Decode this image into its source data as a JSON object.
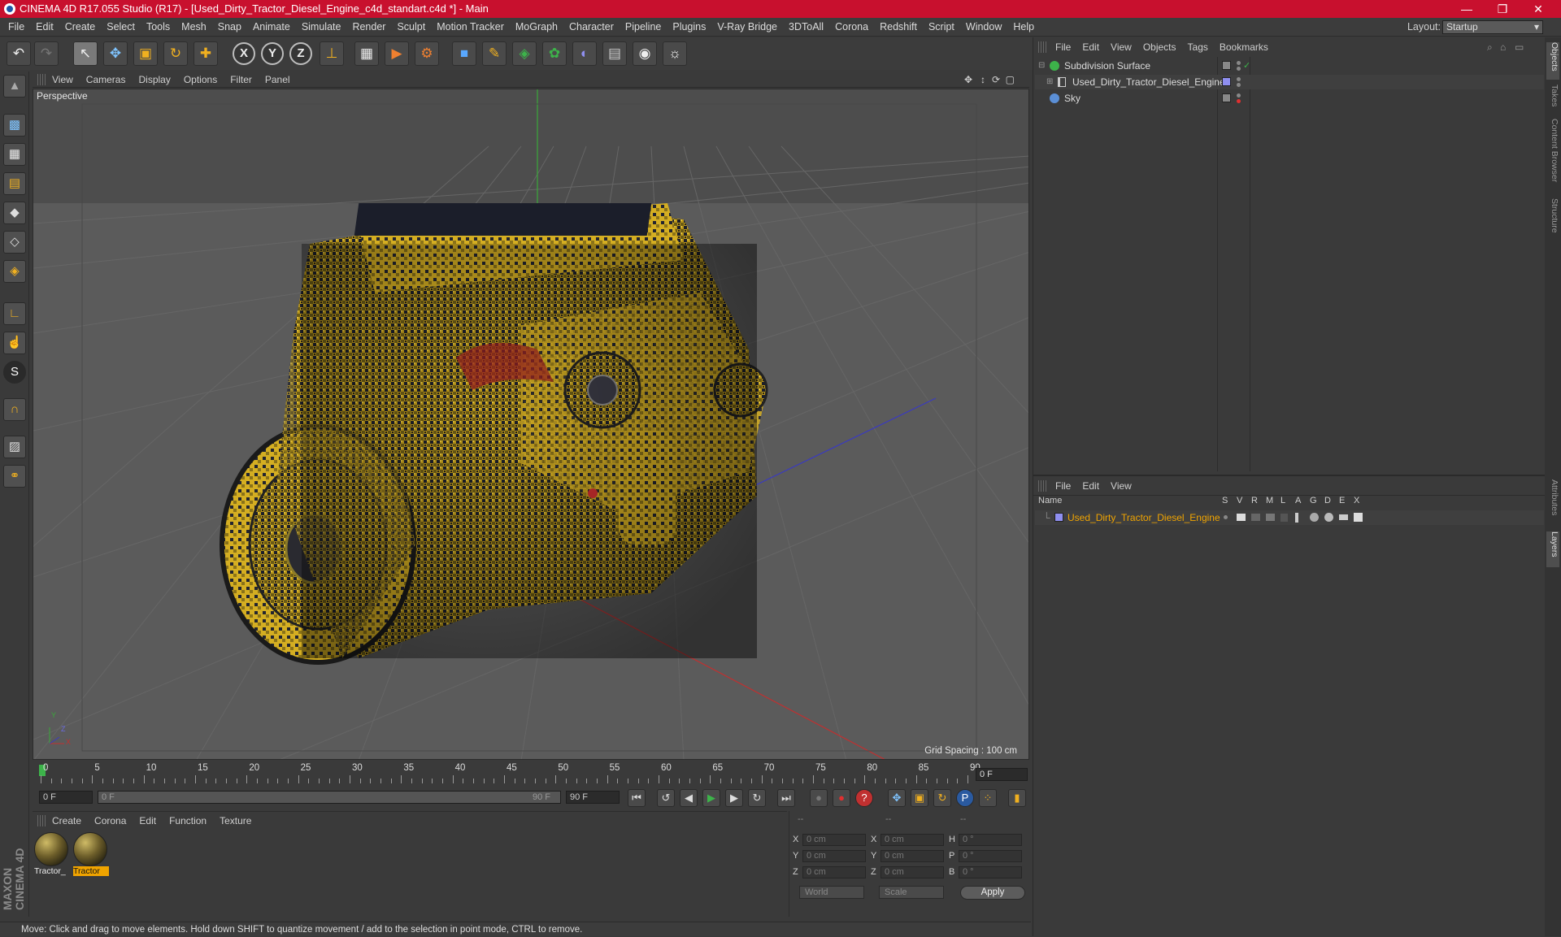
{
  "window": {
    "title": "CINEMA 4D R17.055 Studio (R17) - [Used_Dirty_Tractor_Diesel_Engine_c4d_standart.c4d *] - Main",
    "minimize": "—",
    "maximize": "❐",
    "close": "✕"
  },
  "menubar": {
    "items": [
      "File",
      "Edit",
      "Create",
      "Select",
      "Tools",
      "Mesh",
      "Snap",
      "Animate",
      "Simulate",
      "Render",
      "Sculpt",
      "Motion Tracker",
      "MoGraph",
      "Character",
      "Pipeline",
      "Plugins",
      "V-Ray Bridge",
      "3DToAll",
      "Corona",
      "Redshift",
      "Script",
      "Window",
      "Help"
    ],
    "layout_label": "Layout:",
    "layout_value": "Startup"
  },
  "toolbar": {
    "undo": "↶",
    "redo": "↷",
    "select": "↖",
    "move": "✥",
    "scale": "▣",
    "rotate": "↻",
    "add": "✚",
    "axis_x": "X",
    "axis_y": "Y",
    "axis_z": "Z",
    "coord": "⊥",
    "render_view": "▦",
    "render": "▶",
    "render_settings": "⚙",
    "cube": "■",
    "pen": "✎",
    "subdiv": "◈",
    "array": "✿",
    "deform": "◐",
    "floor": "▤",
    "camera": "◉",
    "light": "☼"
  },
  "lefttools": {
    "t0": "▲",
    "t1": "▩",
    "t2": "▦",
    "t3": "▤",
    "t4": "◆",
    "t5": "◇",
    "t6": "◈",
    "t7": "∟",
    "t8": "☝",
    "t9": "S",
    "t10": "∩",
    "t11": "▨",
    "t12": "⚭",
    "maxon": "MAXON CINEMA 4D"
  },
  "viewport": {
    "menu": [
      "View",
      "Cameras",
      "Display",
      "Options",
      "Filter",
      "Panel"
    ],
    "camera_label": "Perspective",
    "grid_spacing": "Grid Spacing : 100 cm",
    "nav_icons": [
      "✥",
      "↕",
      "⟳",
      "▢"
    ],
    "axis_x": "X",
    "axis_y": "Y",
    "axis_z": "Z"
  },
  "timeline": {
    "ticks": [
      "0",
      "5",
      "10",
      "15",
      "20",
      "25",
      "30",
      "35",
      "40",
      "45",
      "50",
      "55",
      "60",
      "65",
      "70",
      "75",
      "80",
      "85",
      "90"
    ],
    "current_frame": "0 F",
    "start_field": "0 F",
    "range_start": "0 F",
    "range_end": "90 F",
    "end_field": "90 F"
  },
  "transport": {
    "first": "⏮",
    "prev_key": "↺",
    "prev": "◀",
    "play": "▶",
    "next": "▶",
    "next_key": "↻",
    "last": "⏭",
    "record": "●",
    "autokey": "●",
    "help": "?",
    "move": "✥",
    "scale": "▣",
    "rotate": "↻",
    "param": "P",
    "points": "⁘",
    "film": "▮"
  },
  "materials": {
    "menu": [
      "Create",
      "Corona",
      "Edit",
      "Function",
      "Texture"
    ],
    "items": [
      {
        "label": "Tractor_",
        "selected": false
      },
      {
        "label": "Tractor",
        "selected": true
      }
    ]
  },
  "coordinates": {
    "header": [
      "--",
      "--",
      "--"
    ],
    "rows": [
      {
        "a": "X",
        "av": "0 cm",
        "b": "X",
        "bv": "0 cm",
        "c": "H",
        "cv": "0 °"
      },
      {
        "a": "Y",
        "av": "0 cm",
        "b": "Y",
        "bv": "0 cm",
        "c": "P",
        "cv": "0 °"
      },
      {
        "a": "Z",
        "av": "0 cm",
        "b": "Z",
        "bv": "0 cm",
        "c": "B",
        "cv": "0 °"
      }
    ],
    "mode": "World",
    "size_mode": "Scale",
    "apply": "Apply"
  },
  "objects_panel": {
    "menu": [
      "File",
      "Edit",
      "View",
      "Objects",
      "Tags",
      "Bookmarks"
    ],
    "rows": [
      {
        "name": "Subdivision Surface",
        "color": "#3db34a",
        "expand": "⊟"
      },
      {
        "name": "Used_Dirty_Tractor_Diesel_Engine",
        "color": "#8f8ff0",
        "expand": "⊞"
      },
      {
        "name": "Sky",
        "color": "#5b8fd6",
        "expand": ""
      }
    ],
    "check": "✓"
  },
  "layers_panel": {
    "menu": [
      "File",
      "Edit",
      "View"
    ],
    "columns": [
      "Name",
      "S",
      "V",
      "R",
      "M",
      "L",
      "A",
      "G",
      "D",
      "E",
      "X"
    ],
    "rows": [
      {
        "name": "Used_Dirty_Tractor_Diesel_Engine"
      }
    ],
    "layer_color": "#8f8ff0"
  },
  "side_tabs": [
    "Objects",
    "Takes",
    "Content Browser",
    "Structure",
    "Attributes",
    "Layers"
  ],
  "status": "Move: Click and drag to move elements. Hold down SHIFT to quantize movement / add to the selection in point mode, CTRL to remove.",
  "colors": {
    "title_bar": "#c8102e",
    "accent": "#f0a400",
    "engine_yellow": "#c9a21a"
  }
}
